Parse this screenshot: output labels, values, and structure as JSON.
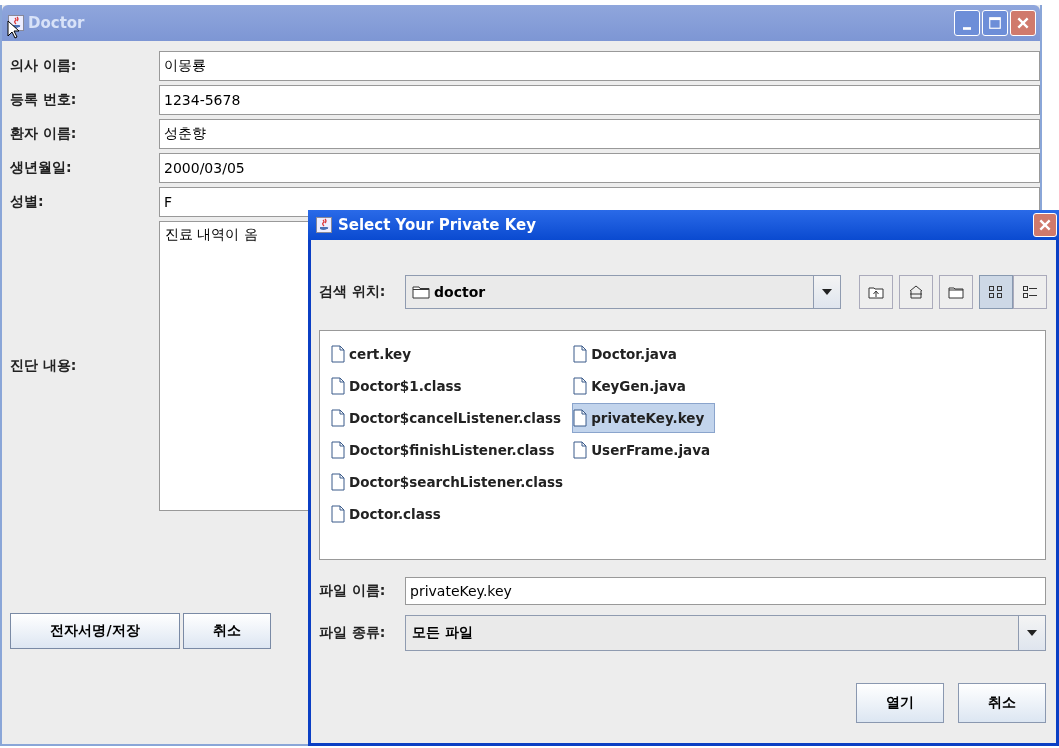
{
  "window": {
    "title": "Doctor",
    "active": false
  },
  "fields": [
    {
      "label": "의사 이름:",
      "value": "이몽룡"
    },
    {
      "label": "등록 번호:",
      "value": "1234-5678"
    },
    {
      "label": "환자 이름:",
      "value": "성춘향"
    },
    {
      "label": "생년월일:",
      "value": "2000/03/05"
    },
    {
      "label": "성별:",
      "value": "F"
    }
  ],
  "diagnosis": {
    "label": "진단 내용:",
    "value": "진료 내역이 옴"
  },
  "buttons": [
    "전자서명/저장",
    "취소"
  ],
  "dialog": {
    "title": "Select Your Private Key",
    "active": true,
    "look_in": {
      "label": "검색 위치:",
      "value": "doctor"
    },
    "toolbar": [
      {
        "kind": "up",
        "selected": false
      },
      {
        "kind": "home",
        "selected": false
      },
      {
        "kind": "new-folder",
        "selected": false
      },
      {
        "kind": "list",
        "selected": true
      },
      {
        "kind": "details",
        "selected": false
      }
    ],
    "files": [
      {
        "name": "cert.key",
        "selected": false
      },
      {
        "name": "Doctor$1.class",
        "selected": false
      },
      {
        "name": "Doctor$cancelListener.class",
        "selected": false
      },
      {
        "name": "Doctor$finishListener.class",
        "selected": false
      },
      {
        "name": "Doctor$searchListener.class",
        "selected": false
      },
      {
        "name": "Doctor.class",
        "selected": false
      },
      {
        "name": "Doctor.java",
        "selected": false
      },
      {
        "name": "KeyGen.java",
        "selected": false
      },
      {
        "name": "privateKey.key",
        "selected": true
      },
      {
        "name": "UserFrame.java",
        "selected": false
      }
    ],
    "file_name": {
      "label": "파일 이름:",
      "value": "privateKey.key"
    },
    "file_type": {
      "label": "파일 종류:",
      "value": "모든 파일"
    },
    "buttons": [
      "열기",
      "취소"
    ]
  }
}
